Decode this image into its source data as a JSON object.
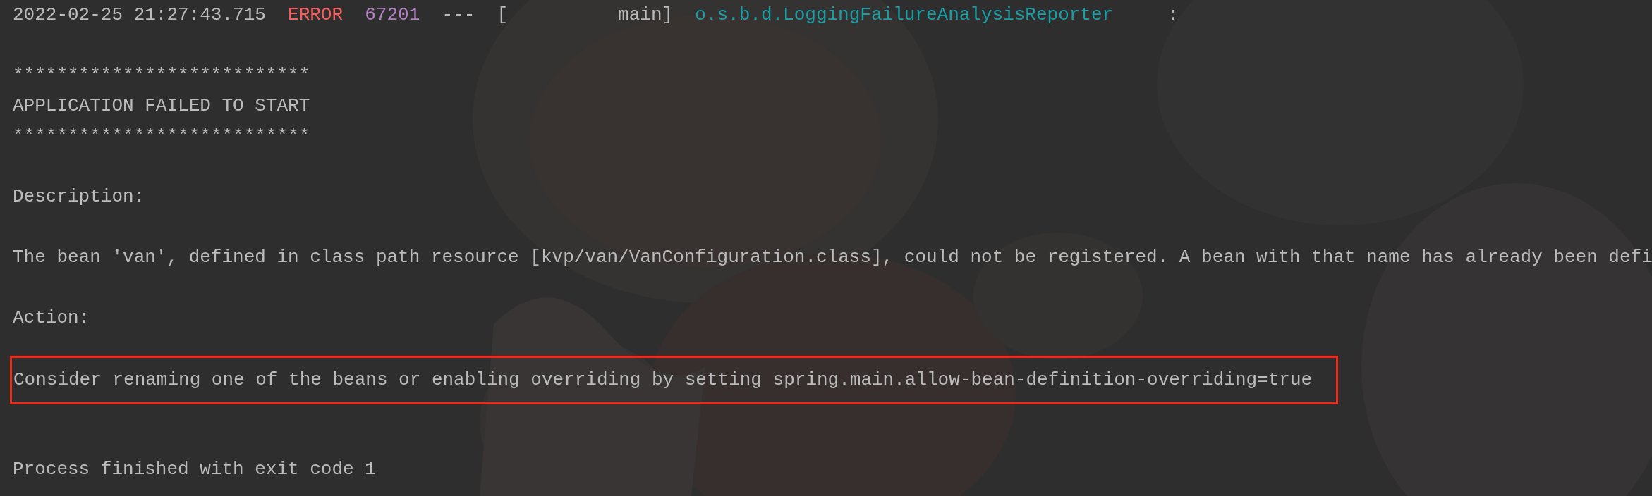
{
  "console": {
    "lines": [
      {
        "kind": "log_header",
        "timestamp": "2022-02-25 21:27:43.715",
        "level": "ERROR",
        "pid": "67201",
        "separator": "---",
        "thread": "[          main]",
        "logger": "o.s.b.d.LoggingFailureAnalysisReporter",
        "delimiter": ":"
      },
      {
        "kind": "blank"
      },
      {
        "kind": "text",
        "text": "***************************"
      },
      {
        "kind": "text",
        "text": "APPLICATION FAILED TO START"
      },
      {
        "kind": "text",
        "text": "***************************"
      },
      {
        "kind": "blank"
      },
      {
        "kind": "text",
        "text": "Description:"
      },
      {
        "kind": "blank"
      },
      {
        "kind": "text",
        "text": "The bean 'van', defined in class path resource [kvp/van/VanConfiguration.class], could not be registered. A bean with that name has already been defi"
      },
      {
        "kind": "blank"
      },
      {
        "kind": "text",
        "text": "Action:"
      },
      {
        "kind": "blank"
      },
      {
        "kind": "highlighted",
        "text": "Consider renaming one of the beans or enabling overriding by setting spring.main.allow-bean-definition-overriding=true"
      },
      {
        "kind": "blank"
      },
      {
        "kind": "blank"
      },
      {
        "kind": "text",
        "text": "Process finished with exit code 1"
      }
    ]
  }
}
